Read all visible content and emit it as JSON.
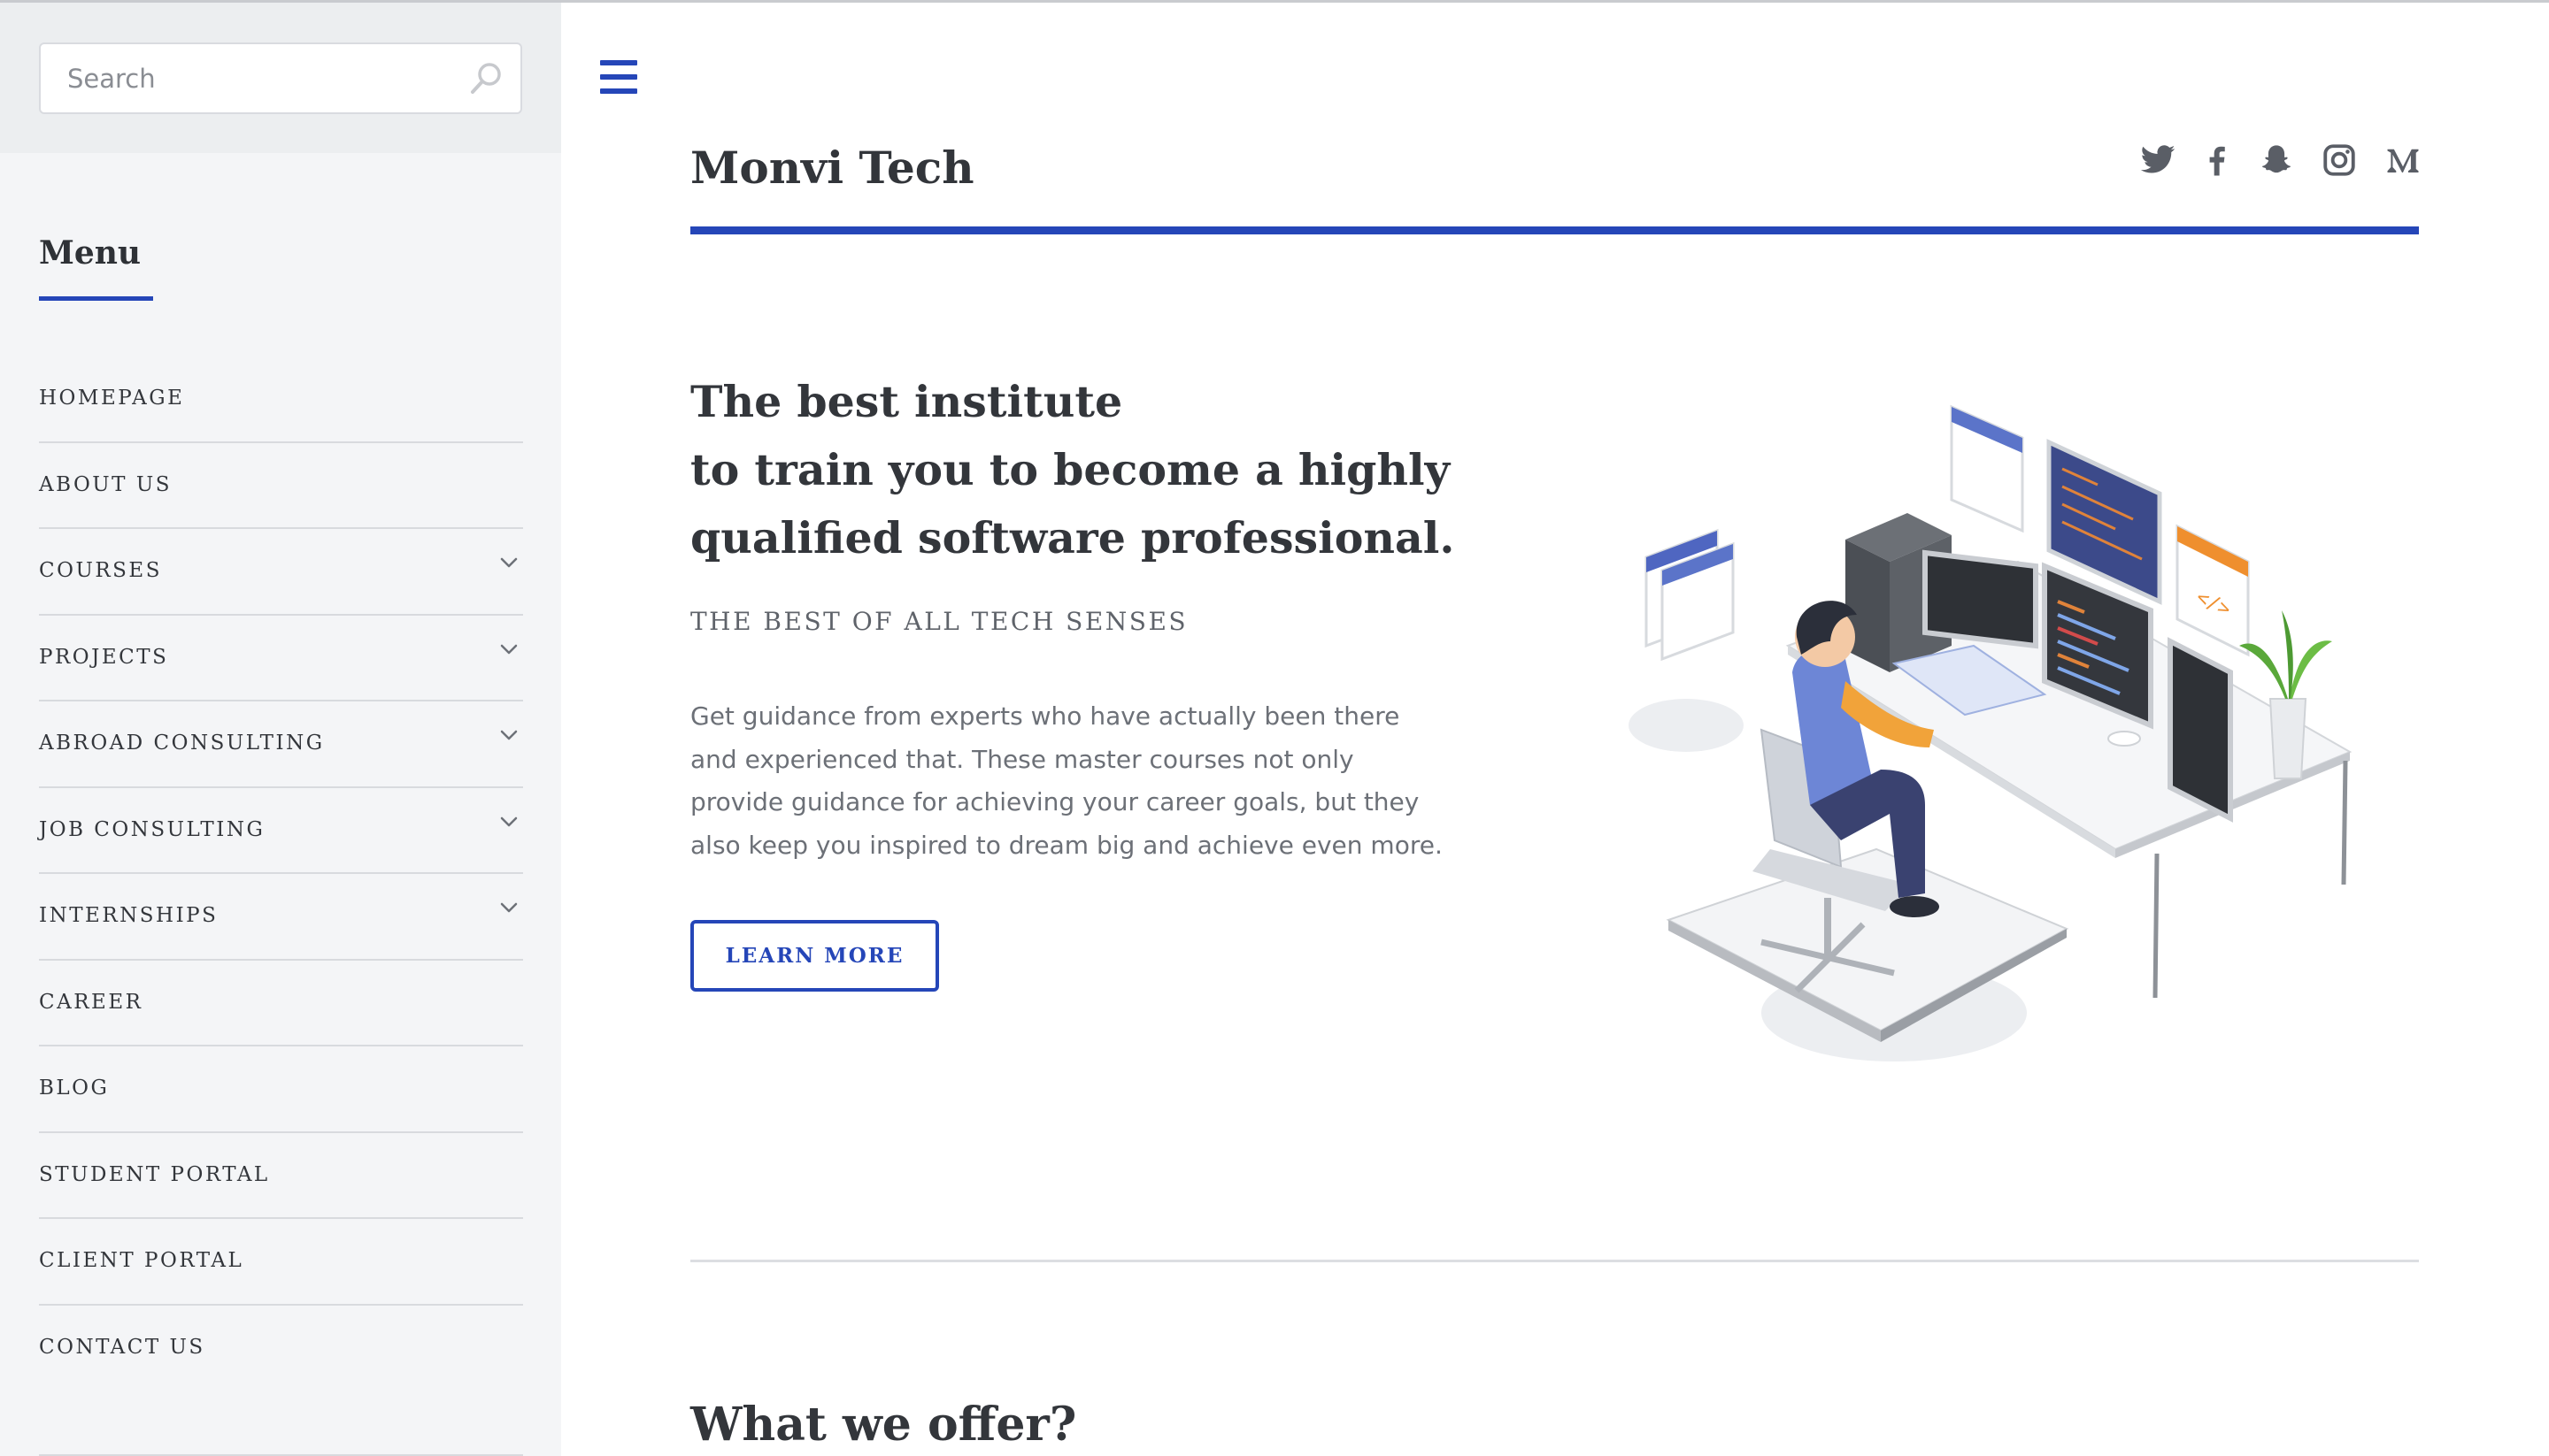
{
  "search": {
    "placeholder": "Search"
  },
  "sidebar": {
    "menu_title": "Menu",
    "items": [
      {
        "label": "HOMEPAGE",
        "has_submenu": false
      },
      {
        "label": "ABOUT US",
        "has_submenu": false
      },
      {
        "label": "COURSES",
        "has_submenu": true
      },
      {
        "label": "PROJECTS",
        "has_submenu": true
      },
      {
        "label": "ABROAD CONSULTING",
        "has_submenu": true
      },
      {
        "label": "JOB CONSULTING",
        "has_submenu": true
      },
      {
        "label": "INTERNSHIPS",
        "has_submenu": true
      },
      {
        "label": "CAREER",
        "has_submenu": false
      },
      {
        "label": "BLOG",
        "has_submenu": false
      },
      {
        "label": "STUDENT PORTAL",
        "has_submenu": false
      },
      {
        "label": "CLIENT PORTAL",
        "has_submenu": false
      },
      {
        "label": "CONTACT US",
        "has_submenu": false
      }
    ]
  },
  "header": {
    "site_title": "Monvi Tech",
    "social_icons": [
      "twitter-icon",
      "facebook-icon",
      "snapchat-icon",
      "instagram-icon",
      "medium-icon"
    ]
  },
  "hero": {
    "title_lines": [
      "The best institute",
      "to train you to become a highly",
      "qualified software professional."
    ],
    "tagline": "THE BEST OF ALL TECH SENSES",
    "body": "Get guidance from experts who have actually been there and experienced that. These master courses not only provide guidance for achieving your career goals, but they also keep you inspired to dream big and achieve even more.",
    "button_label": "LEARN MORE"
  },
  "offer": {
    "title": "What we offer?"
  },
  "colors": {
    "accent": "#2546b8",
    "sidebar_bg": "#f4f5f7",
    "text": "#33363b",
    "muted_text": "#6c7077",
    "icon_gray": "#5a5e66"
  }
}
